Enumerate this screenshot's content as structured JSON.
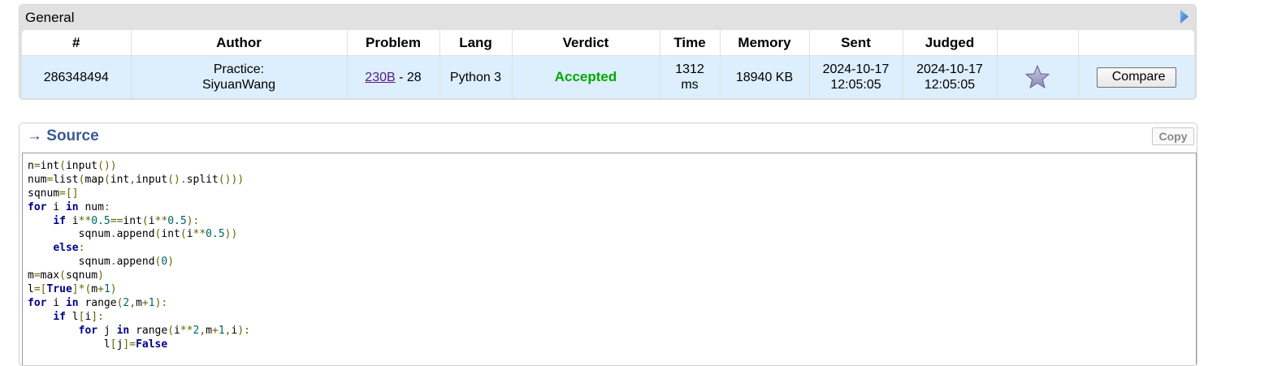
{
  "general": {
    "title": "General",
    "columns": [
      "#",
      "Author",
      "Problem",
      "Lang",
      "Verdict",
      "Time",
      "Memory",
      "Sent",
      "Judged",
      "",
      ""
    ],
    "row": {
      "id": "286348494",
      "author_line1": "Practice:",
      "author_line2": "SiyuanWang",
      "problem_link": "230B",
      "problem_suffix": " - 28",
      "lang": "Python 3",
      "verdict": "Accepted",
      "time_line1": "1312",
      "time_line2": "ms",
      "memory": "18940 KB",
      "sent_date": "2024-10-17",
      "sent_time": "12:05:05",
      "judged_date": "2024-10-17",
      "judged_time": "12:05:05",
      "compare_label": "Compare"
    },
    "colors": {
      "verdict_accepted": "#00a900",
      "row_bg": "#ddeefc",
      "link": "#551a8b"
    }
  },
  "source": {
    "title": "→ Source",
    "copy_label": "Copy",
    "title_color": "#3b5998",
    "code_lines": [
      [
        [
          "t",
          "n=int(input())"
        ]
      ],
      [
        [
          "t",
          "num=list(map(int,input().split()))"
        ]
      ],
      [
        [
          "t",
          "sqnum=[]"
        ]
      ],
      [
        [
          "k",
          "for"
        ],
        [
          "t",
          " i "
        ],
        [
          "k",
          "in"
        ],
        [
          "t",
          " num:"
        ]
      ],
      [
        [
          "t",
          "    "
        ],
        [
          "k",
          "if"
        ],
        [
          "t",
          " i**0.5==int(i**0.5):"
        ]
      ],
      [
        [
          "t",
          "        sqnum.append(int(i**0.5))"
        ]
      ],
      [
        [
          "t",
          "    "
        ],
        [
          "k",
          "else"
        ],
        [
          "t",
          ":"
        ]
      ],
      [
        [
          "t",
          "        sqnum.append(0)"
        ]
      ],
      [
        [
          "t",
          "m=max(sqnum)"
        ]
      ],
      [
        [
          "t",
          "l=["
        ],
        [
          "k",
          "True"
        ],
        [
          "t",
          "]*(m+1)"
        ]
      ],
      [
        [
          "k",
          "for"
        ],
        [
          "t",
          " i "
        ],
        [
          "k",
          "in"
        ],
        [
          "t",
          " range(2,m+1):"
        ]
      ],
      [
        [
          "t",
          "    "
        ],
        [
          "k",
          "if"
        ],
        [
          "t",
          " l[i]:"
        ]
      ],
      [
        [
          "t",
          "        "
        ],
        [
          "k",
          "for"
        ],
        [
          "t",
          " j "
        ],
        [
          "k",
          "in"
        ],
        [
          "t",
          " range(i**2,m+1,i):"
        ]
      ],
      [
        [
          "t",
          "            l[j]="
        ],
        [
          "k",
          "False"
        ]
      ]
    ]
  }
}
